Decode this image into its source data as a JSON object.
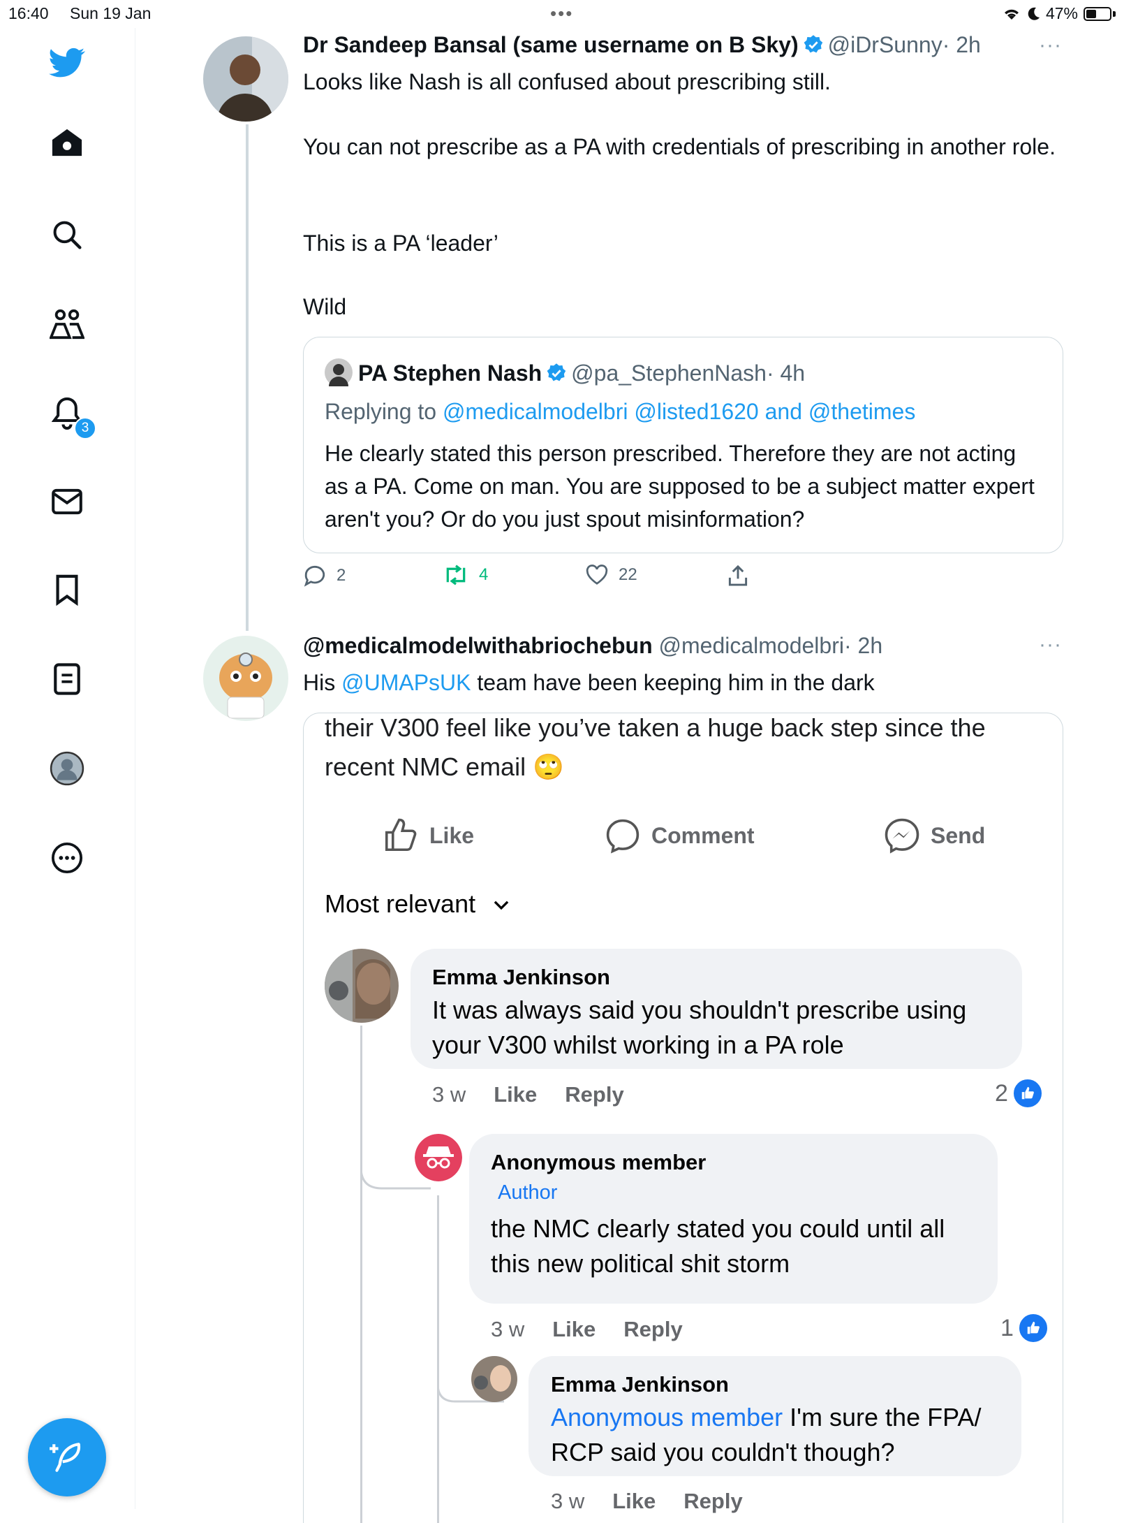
{
  "status": {
    "time": "16:40",
    "date": "Sun 19 Jan",
    "dots": "•••",
    "battery": "47%"
  },
  "sidebar": {
    "notification_count": "3",
    "items": [
      "twitter-logo",
      "home-icon",
      "search-icon",
      "communities-icon",
      "notifications-icon",
      "messages-icon",
      "bookmarks-icon",
      "lists-icon",
      "profile-icon",
      "more-icon"
    ]
  },
  "tweet1": {
    "name": "Dr Sandeep Bansal (same username on B Sky)",
    "handle": "@iDrSunny",
    "time": "· 2h",
    "more": "···",
    "lines": [
      "Looks like Nash is all confused about prescribing still.",
      "You can not prescribe as a PA with credentials of prescribing in another role.",
      "This is a PA ‘leader’",
      "Wild"
    ],
    "quote": {
      "name": "PA Stephen Nash",
      "handle": "@pa_StephenNash",
      "time": "· 4h",
      "replying_prefix": "Replying to",
      "replying_to": "@medicalmodelbri @listed1620 and @thetimes",
      "text": "He clearly stated this person prescribed. Therefore they are not acting as a PA. Come on man. You are  supposed to be a subject matter expert aren't you? Or do you just spout misinformation?"
    },
    "actions": {
      "replies": "2",
      "retweets": "4",
      "likes": "22"
    }
  },
  "tweet2": {
    "name": "@medicalmodelwithabriochebun",
    "handle": "@medicalmodelbri",
    "time": "· 2h",
    "more": "···",
    "text_prefix": "His",
    "mention": "@UMAPsUK",
    "text_suffix": "team have been keeping him in the dark",
    "image": {
      "post_line1": "their V300 feel like you’ve taken a huge back step since the",
      "post_line2": "recent NMC email",
      "emoji": "🙄",
      "like": "Like",
      "comment": "Comment",
      "send": "Send",
      "sort": "Most relevant",
      "comments": [
        {
          "name": "Emma Jenkinson",
          "text": "It was always said you shouldn't prescribe using your V300 whilst working in a PA role",
          "age": "3 w",
          "like": "Like",
          "reply": "Reply",
          "reactions": "2"
        },
        {
          "name": "Anonymous member",
          "badge": "Author",
          "text": "the NMC clearly stated you could until all this new political shit storm",
          "age": "3 w",
          "like": "Like",
          "reply": "Reply",
          "reactions": "1"
        },
        {
          "name": "Emma Jenkinson",
          "mention": "Anonymous member",
          "text": "I'm sure the FPA/ RCP said you couldn't though?",
          "age": "3 w",
          "like": "Like",
          "reply": "Reply"
        }
      ]
    }
  },
  "colors": {
    "accent": "#1d9bf0",
    "retweet": "#00ba7c",
    "fb_blue": "#1877f2"
  }
}
